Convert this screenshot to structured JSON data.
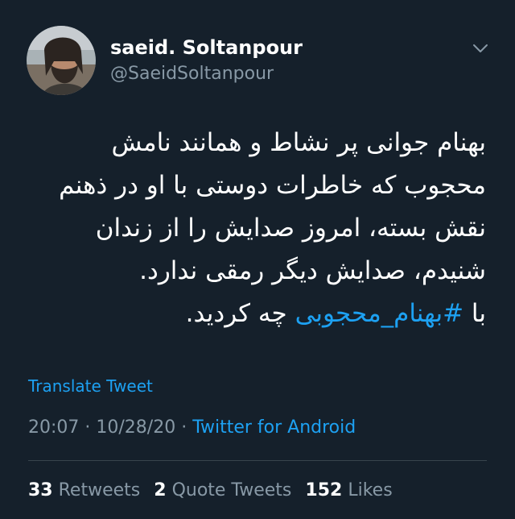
{
  "user": {
    "name": "saeid. Soltanpour",
    "handle": "@SaeidSoltanpour"
  },
  "tweet": {
    "lines": [
      "بهنام جوانی پر نشاط و همانند نامش",
      "محجوب که خاطرات دوستی با او در ذهنم",
      "نقش بسته، امروز صدایش را از زندان",
      "شنیدم، صدایش دیگر رمقی ندارد."
    ],
    "last_line_prefix": "با ",
    "hashtag": "#بهنام_محجوبی",
    "last_line_suffix": " چه کردید."
  },
  "translate_label": "Translate Tweet",
  "meta": {
    "time": "20:07",
    "sep1": " · ",
    "date": "10/28/20",
    "sep2": " · ",
    "source": "Twitter for Android"
  },
  "stats": {
    "retweets_count": "33",
    "retweets_label": "Retweets",
    "quotes_count": "2",
    "quotes_label": "Quote Tweets",
    "likes_count": "152",
    "likes_label": "Likes"
  },
  "icons": {
    "menu": "chevron-down-icon"
  },
  "colors": {
    "background": "#15202b",
    "accent": "#1da1f2",
    "secondary_text": "#8899a6",
    "divider": "#38444d"
  }
}
